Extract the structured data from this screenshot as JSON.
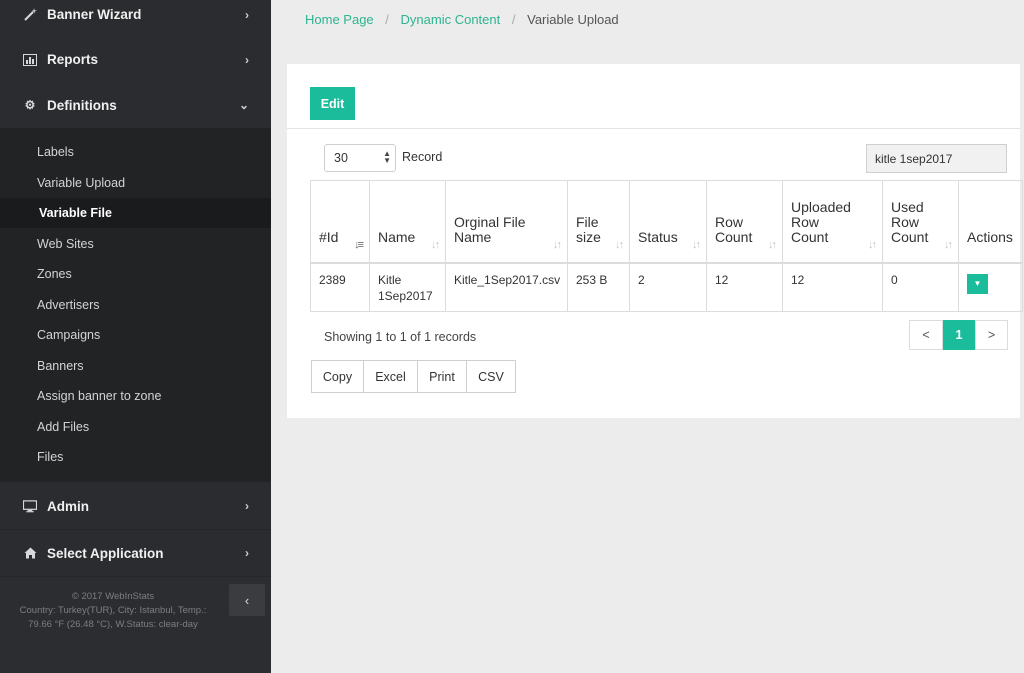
{
  "sidebar": {
    "top_items": [
      {
        "label": "Banner Wizard",
        "icon": "magic-wand-icon"
      },
      {
        "label": "Reports",
        "icon": "bar-chart-icon"
      },
      {
        "label": "Definitions",
        "icon": "gear-icon"
      }
    ],
    "definitions_items": [
      "Labels",
      "Variable Upload",
      "Variable File",
      "Web Sites",
      "Zones",
      "Advertisers",
      "Campaigns",
      "Banners",
      "Assign banner to zone",
      "Add Files",
      "Files"
    ],
    "active_item": "Variable File",
    "bottom_items": [
      {
        "label": "Admin",
        "icon": "monitor-icon"
      },
      {
        "label": "Select Application",
        "icon": "home-icon"
      }
    ],
    "footer": {
      "copyright": "© 2017 WebInStats",
      "line1": "Country: Turkey(TUR), City: Istanbul, Temp.:",
      "line2": "79.66 °F (26.48 °C), W.Status: clear-day"
    }
  },
  "breadcrumb": {
    "home": "Home Page",
    "section": "Dynamic Content",
    "current": "Variable Upload",
    "separator": "/"
  },
  "toolbar": {
    "edit_label": "Edit"
  },
  "table_controls": {
    "page_length": "30",
    "record_label": "Record",
    "search_value": "kitle 1sep2017"
  },
  "table": {
    "columns": [
      {
        "line1": "#Id",
        "line2": "",
        "line3": ""
      },
      {
        "line1": "Name",
        "line2": "",
        "line3": ""
      },
      {
        "line1": "Orginal File",
        "line2": "Name",
        "line3": ""
      },
      {
        "line1": "File",
        "line2": "size",
        "line3": ""
      },
      {
        "line1": "Status",
        "line2": "",
        "line3": ""
      },
      {
        "line1": "Row",
        "line2": "Count",
        "line3": ""
      },
      {
        "line1": "Uploaded",
        "line2": "Row",
        "line3": "Count"
      },
      {
        "line1": "Used",
        "line2": "Row",
        "line3": "Count"
      },
      {
        "line1": "Actions",
        "line2": "",
        "line3": ""
      }
    ],
    "rows": [
      {
        "id": "2389",
        "name_line1": "Kitle",
        "name_line2": "1Sep2017",
        "original_file_name": "Kitle_1Sep2017.csv",
        "file_size": "253 B",
        "status": "2",
        "row_count": "12",
        "uploaded_row_count": "12",
        "used_row_count": "0"
      }
    ]
  },
  "info_text": "Showing 1 to 1 of 1 records",
  "pagination": {
    "prev": "<",
    "current": "1",
    "next": ">"
  },
  "export_buttons": [
    "Copy",
    "Excel",
    "Print",
    "CSV"
  ],
  "colors": {
    "accent": "#1bbc9b",
    "sidebar_bg": "#2b2d30",
    "link": "#2bb48f"
  }
}
